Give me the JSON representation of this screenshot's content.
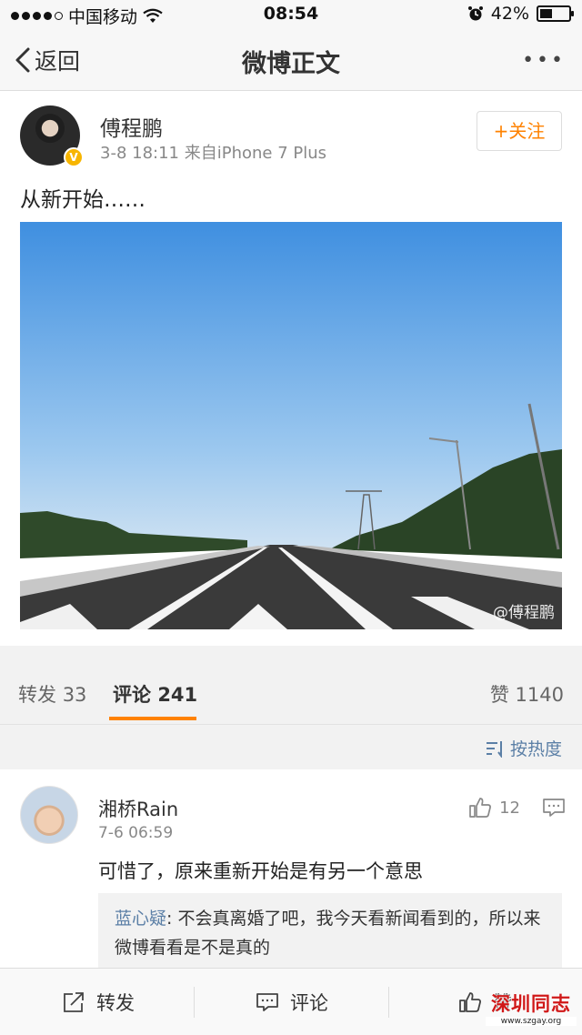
{
  "status_bar": {
    "carrier": "中国移动",
    "time": "08:54",
    "battery_percent": "42%",
    "battery_level": 0.42
  },
  "nav": {
    "back_label": "返回",
    "title": "微博正文",
    "more_label": "•••"
  },
  "post": {
    "author": "傅程鹏",
    "meta": "3-8 18:11  来自iPhone 7 Plus",
    "follow_label": "+关注",
    "text": "从新开始……",
    "image_watermark": "@傅程鹏"
  },
  "tabs": {
    "repost_label": "转发",
    "repost_count": "33",
    "comment_label": "评论",
    "comment_count": "241",
    "like_label": "赞",
    "like_count": "1140"
  },
  "sort": {
    "label": "按热度"
  },
  "comment": {
    "author": "湘桥Rain",
    "time": "7-6 06:59",
    "like_count": "12",
    "text": "可惜了，原来重新开始是有另一个意思",
    "reply_author": "蓝心疑",
    "reply_text": ": 不会真离婚了吧，我今天看新闻看到的，所以来微博看看是不是真的"
  },
  "bottom_bar": {
    "repost_label": "转发",
    "comment_label": "评论",
    "like_label": "赞"
  },
  "overlay_logo": {
    "title": "深圳同志",
    "url": "www.szgay.org"
  },
  "colors": {
    "accent": "#ff8200",
    "link": "#5b7fa6"
  }
}
